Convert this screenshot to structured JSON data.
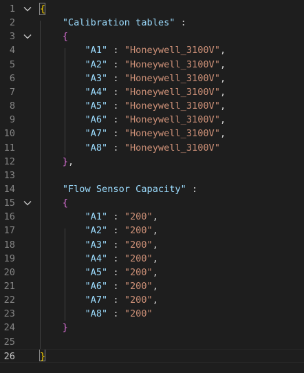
{
  "editor": {
    "language": "json",
    "current_line": 26,
    "colors": {
      "background": "#1e1e1e",
      "line_number": "#858585",
      "line_number_active": "#c6c6c6",
      "brace_level1": "#ffd700",
      "brace_level2": "#da70d6",
      "key": "#9cdcfe",
      "string": "#ce9178",
      "punctuation": "#d4d4d4"
    },
    "lines": [
      {
        "n": "1",
        "fold": true,
        "tokens": [
          {
            "t": "{",
            "c": "brace1"
          }
        ]
      },
      {
        "n": "2",
        "fold": false,
        "tokens": [
          {
            "t": "    "
          },
          {
            "t": "\"Calibration tables\"",
            "c": "key"
          },
          {
            "t": " :",
            "c": "punct"
          }
        ]
      },
      {
        "n": "3",
        "fold": true,
        "tokens": [
          {
            "t": "    "
          },
          {
            "t": "{",
            "c": "brace2"
          }
        ]
      },
      {
        "n": "4",
        "fold": false,
        "tokens": [
          {
            "t": "        "
          },
          {
            "t": "\"A1\"",
            "c": "key"
          },
          {
            "t": " : ",
            "c": "punct"
          },
          {
            "t": "\"Honeywell_3100V\"",
            "c": "str"
          },
          {
            "t": ",",
            "c": "punct"
          }
        ]
      },
      {
        "n": "5",
        "fold": false,
        "tokens": [
          {
            "t": "        "
          },
          {
            "t": "\"A2\"",
            "c": "key"
          },
          {
            "t": " : ",
            "c": "punct"
          },
          {
            "t": "\"Honeywell_3100V\"",
            "c": "str"
          },
          {
            "t": ",",
            "c": "punct"
          }
        ]
      },
      {
        "n": "6",
        "fold": false,
        "tokens": [
          {
            "t": "        "
          },
          {
            "t": "\"A3\"",
            "c": "key"
          },
          {
            "t": " : ",
            "c": "punct"
          },
          {
            "t": "\"Honeywell_3100V\"",
            "c": "str"
          },
          {
            "t": ",",
            "c": "punct"
          }
        ]
      },
      {
        "n": "7",
        "fold": false,
        "tokens": [
          {
            "t": "        "
          },
          {
            "t": "\"A4\"",
            "c": "key"
          },
          {
            "t": " : ",
            "c": "punct"
          },
          {
            "t": "\"Honeywell_3100V\"",
            "c": "str"
          },
          {
            "t": ",",
            "c": "punct"
          }
        ]
      },
      {
        "n": "8",
        "fold": false,
        "tokens": [
          {
            "t": "        "
          },
          {
            "t": "\"A5\"",
            "c": "key"
          },
          {
            "t": " : ",
            "c": "punct"
          },
          {
            "t": "\"Honeywell_3100V\"",
            "c": "str"
          },
          {
            "t": ",",
            "c": "punct"
          }
        ]
      },
      {
        "n": "9",
        "fold": false,
        "tokens": [
          {
            "t": "        "
          },
          {
            "t": "\"A6\"",
            "c": "key"
          },
          {
            "t": " : ",
            "c": "punct"
          },
          {
            "t": "\"Honeywell_3100V\"",
            "c": "str"
          },
          {
            "t": ",",
            "c": "punct"
          }
        ]
      },
      {
        "n": "10",
        "fold": false,
        "tokens": [
          {
            "t": "        "
          },
          {
            "t": "\"A7\"",
            "c": "key"
          },
          {
            "t": " : ",
            "c": "punct"
          },
          {
            "t": "\"Honeywell_3100V\"",
            "c": "str"
          },
          {
            "t": ",",
            "c": "punct"
          }
        ]
      },
      {
        "n": "11",
        "fold": false,
        "tokens": [
          {
            "t": "        "
          },
          {
            "t": "\"A8\"",
            "c": "key"
          },
          {
            "t": " : ",
            "c": "punct"
          },
          {
            "t": "\"Honeywell_3100V\"",
            "c": "str"
          }
        ]
      },
      {
        "n": "12",
        "fold": false,
        "tokens": [
          {
            "t": "    "
          },
          {
            "t": "}",
            "c": "brace2"
          },
          {
            "t": ",",
            "c": "punct"
          }
        ]
      },
      {
        "n": "13",
        "fold": false,
        "tokens": []
      },
      {
        "n": "14",
        "fold": false,
        "tokens": [
          {
            "t": "    "
          },
          {
            "t": "\"Flow Sensor Capacity\"",
            "c": "key"
          },
          {
            "t": " :",
            "c": "punct"
          }
        ]
      },
      {
        "n": "15",
        "fold": true,
        "tokens": [
          {
            "t": "    "
          },
          {
            "t": "{",
            "c": "brace2"
          }
        ]
      },
      {
        "n": "16",
        "fold": false,
        "tokens": [
          {
            "t": "        "
          },
          {
            "t": "\"A1\"",
            "c": "key"
          },
          {
            "t": " : ",
            "c": "punct"
          },
          {
            "t": "\"200\"",
            "c": "str"
          },
          {
            "t": ",",
            "c": "punct"
          }
        ]
      },
      {
        "n": "17",
        "fold": false,
        "tokens": [
          {
            "t": "        "
          },
          {
            "t": "\"A2\"",
            "c": "key"
          },
          {
            "t": " : ",
            "c": "punct"
          },
          {
            "t": "\"200\"",
            "c": "str"
          },
          {
            "t": ",",
            "c": "punct"
          }
        ]
      },
      {
        "n": "18",
        "fold": false,
        "tokens": [
          {
            "t": "        "
          },
          {
            "t": "\"A3\"",
            "c": "key"
          },
          {
            "t": " : ",
            "c": "punct"
          },
          {
            "t": "\"200\"",
            "c": "str"
          },
          {
            "t": ",",
            "c": "punct"
          }
        ]
      },
      {
        "n": "19",
        "fold": false,
        "tokens": [
          {
            "t": "        "
          },
          {
            "t": "\"A4\"",
            "c": "key"
          },
          {
            "t": " : ",
            "c": "punct"
          },
          {
            "t": "\"200\"",
            "c": "str"
          },
          {
            "t": ",",
            "c": "punct"
          }
        ]
      },
      {
        "n": "20",
        "fold": false,
        "tokens": [
          {
            "t": "        "
          },
          {
            "t": "\"A5\"",
            "c": "key"
          },
          {
            "t": " : ",
            "c": "punct"
          },
          {
            "t": "\"200\"",
            "c": "str"
          },
          {
            "t": ",",
            "c": "punct"
          }
        ]
      },
      {
        "n": "21",
        "fold": false,
        "tokens": [
          {
            "t": "        "
          },
          {
            "t": "\"A6\"",
            "c": "key"
          },
          {
            "t": " : ",
            "c": "punct"
          },
          {
            "t": "\"200\"",
            "c": "str"
          },
          {
            "t": ",",
            "c": "punct"
          }
        ]
      },
      {
        "n": "22",
        "fold": false,
        "tokens": [
          {
            "t": "        "
          },
          {
            "t": "\"A7\"",
            "c": "key"
          },
          {
            "t": " : ",
            "c": "punct"
          },
          {
            "t": "\"200\"",
            "c": "str"
          },
          {
            "t": ",",
            "c": "punct"
          }
        ]
      },
      {
        "n": "23",
        "fold": false,
        "tokens": [
          {
            "t": "        "
          },
          {
            "t": "\"A8\"",
            "c": "key"
          },
          {
            "t": " : ",
            "c": "punct"
          },
          {
            "t": "\"200\"",
            "c": "str"
          }
        ]
      },
      {
        "n": "24",
        "fold": false,
        "tokens": [
          {
            "t": "    "
          },
          {
            "t": "}",
            "c": "brace2"
          }
        ]
      },
      {
        "n": "25",
        "fold": false,
        "tokens": []
      },
      {
        "n": "26",
        "fold": false,
        "tokens": [
          {
            "t": "}",
            "c": "brace1"
          }
        ]
      }
    ]
  }
}
